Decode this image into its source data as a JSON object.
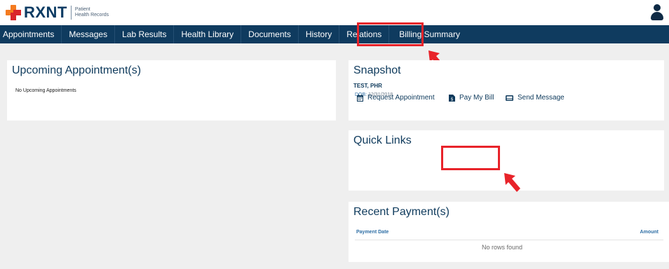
{
  "header": {
    "brand": "RXNT",
    "brand_sub_line1": "Patient",
    "brand_sub_line2": "Health Records"
  },
  "nav": {
    "items": [
      {
        "label": "Appointments"
      },
      {
        "label": "Messages"
      },
      {
        "label": "Lab Results"
      },
      {
        "label": "Health Library"
      },
      {
        "label": "Documents"
      },
      {
        "label": "History"
      },
      {
        "label": "Relations"
      },
      {
        "label": "Billing Summary"
      }
    ]
  },
  "upcoming": {
    "title": "Upcoming Appointment(s)",
    "empty_text": "No Upcoming Appointments"
  },
  "snapshot": {
    "title": "Snapshot",
    "patient_name": "TEST, PHR",
    "dob_label": "DOB:",
    "dob_value": "12/31/2018"
  },
  "quick_links": {
    "title": "Quick Links",
    "request_appointment": "Request Appointment",
    "pay_my_bill": "Pay My Bill",
    "send_message": "Send Message"
  },
  "recent_payments": {
    "title": "Recent Payment(s)",
    "columns": [
      "Payment Date",
      "Amount"
    ],
    "empty_text": "No rows found"
  },
  "colors": {
    "nav_bg": "#0f3b5f",
    "highlight": "#e8232a",
    "brand_orange": "#f47b20"
  }
}
